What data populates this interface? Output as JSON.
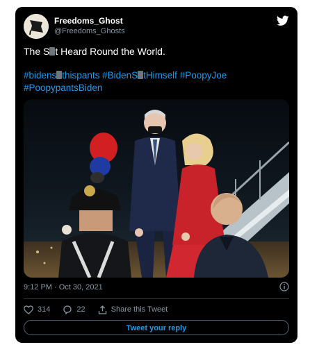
{
  "author": {
    "name": "Freedoms_Ghost",
    "handle": "@Freedoms_Ghosts"
  },
  "tweet": {
    "text_before": "The S",
    "text_after": "t Heard Round the World.",
    "hashtags_line1": [
      {
        "before": "#bidens",
        "after": "thispants"
      },
      {
        "before": "#BidenS",
        "after": "tHimself"
      },
      {
        "text": "#PoopyJoe"
      }
    ],
    "hashtags_line2": "#PoopypantsBiden",
    "timestamp": "9:12 PM · Oct 30, 2021"
  },
  "actions": {
    "likes": "314",
    "replies": "22",
    "share_label": "Share this Tweet"
  },
  "reply_button": "Tweet your reply",
  "colors": {
    "link": "#1d9bf0",
    "muted": "#8b98a5",
    "card": "#000000"
  },
  "icons": [
    "twitter-bird-icon",
    "info-icon",
    "heart-icon",
    "reply-icon",
    "share-icon"
  ]
}
